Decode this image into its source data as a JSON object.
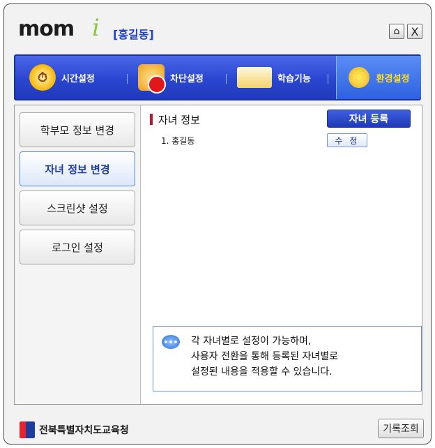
{
  "window": {
    "logo_text": "mom",
    "logo_accent": "i",
    "user_name": "[홍길동]",
    "home_icon": "home-icon",
    "close_label": "X"
  },
  "tabs": [
    {
      "label": "시간설정",
      "icon": "alarm-clock-icon"
    },
    {
      "label": "차단설정",
      "icon": "block-icon"
    },
    {
      "label": "학습기능",
      "icon": "book-icon"
    },
    {
      "label": "환경설정",
      "icon": "gear-icon",
      "active": true
    }
  ],
  "sidebar": {
    "items": [
      {
        "label": "학부모 정보 변경"
      },
      {
        "label": "자녀 정보 변경",
        "active": true
      },
      {
        "label": "스크린샷 설정"
      },
      {
        "label": "로그인 설정"
      }
    ]
  },
  "content": {
    "section_title": "자녀 정보",
    "register_button": "자녀 등록",
    "children": [
      {
        "label": "1. 홍길동",
        "edit_button": "수 정"
      }
    ],
    "info": {
      "icon": "speech-bubble-icon",
      "lines": [
        "각 자녀별로 설정이 가능하며,",
        "사용자 전환을 통해 등록된 자녀별로",
        "설정된 내용을 적용할 수 있습니다."
      ]
    }
  },
  "footer": {
    "org_name": "전북특별자치도교육청",
    "history_button": "기록조회"
  },
  "colors": {
    "accent_blue": "#2a46d0",
    "active_tab_text": "#ffe020",
    "logo_green": "#8cc63f",
    "section_mark": "#c8102e"
  }
}
